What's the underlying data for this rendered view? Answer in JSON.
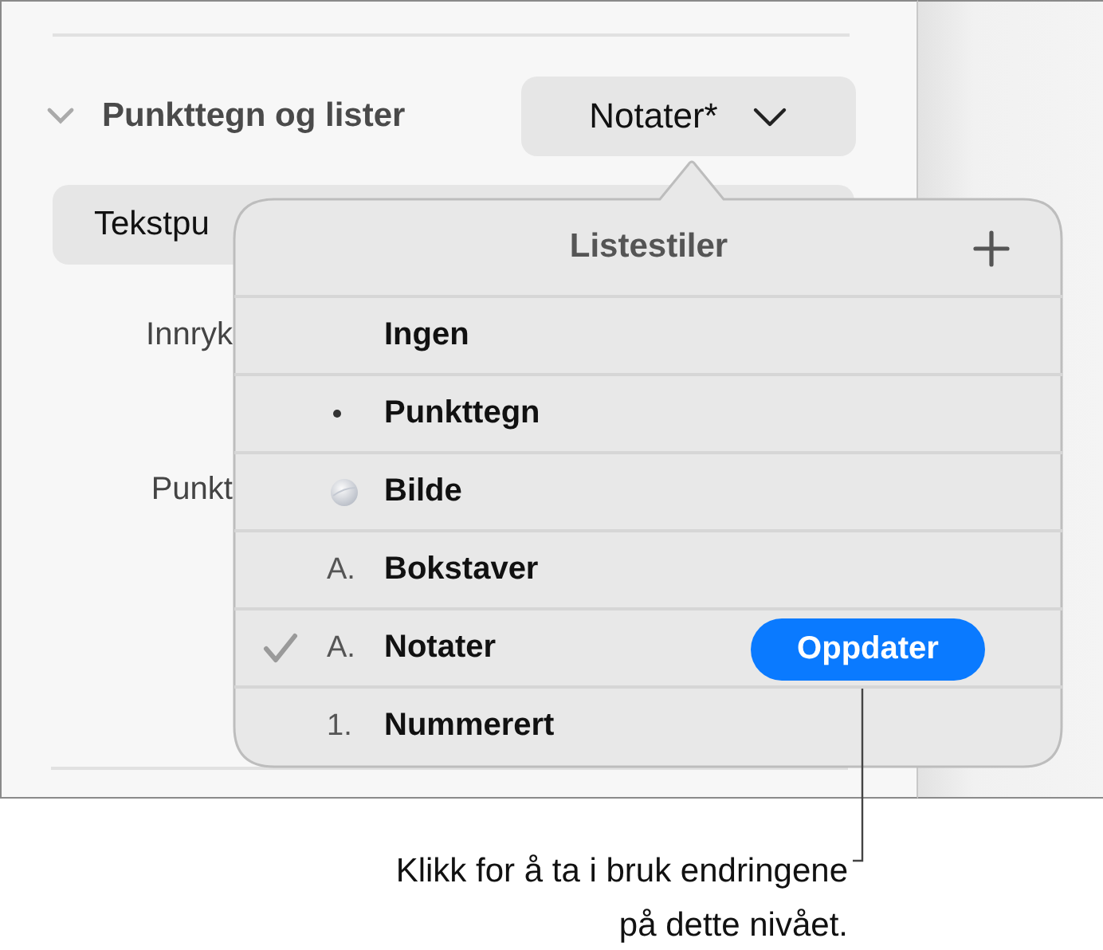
{
  "panel": {
    "section": {
      "title": "Punkttegn og lister",
      "expanded": true,
      "style_popup": "Notater*"
    },
    "bullet_type_popup": "Tekstpu",
    "labels": [
      "Innryk",
      "Punkt"
    ]
  },
  "popover": {
    "title": "Listestiler",
    "items": [
      {
        "kind": "none",
        "label": "Ingen",
        "selected": false
      },
      {
        "kind": "bullet",
        "label": "Punkttegn",
        "selected": false
      },
      {
        "kind": "image",
        "label": "Bilde",
        "selected": false
      },
      {
        "kind": "text",
        "marker": "A.",
        "label": "Bokstaver",
        "selected": false
      },
      {
        "kind": "text",
        "marker": "A.",
        "label": "Notater",
        "selected": true,
        "update_button": "Oppdater"
      },
      {
        "kind": "text",
        "marker": "1.",
        "label": "Nummerert",
        "selected": false
      }
    ]
  },
  "callout": {
    "lines": [
      "Klikk for å ta i bruk endringene",
      "på dette nivået."
    ]
  }
}
